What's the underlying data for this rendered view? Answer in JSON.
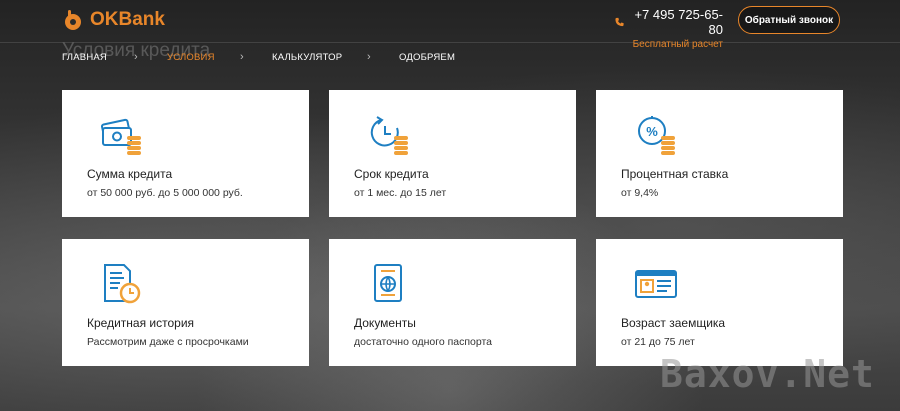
{
  "brand": {
    "name": "OKBank"
  },
  "header": {
    "phone": "+7 495 725-65-80",
    "phone_note": "Бесплатный расчет",
    "callback_label": "Обратный звонок"
  },
  "page_title": "Условия кредита",
  "breadcrumb": [
    "ГЛАВНАЯ",
    "УСЛОВИЯ",
    "КАЛЬКУЛЯТОР",
    "ОДОБРЯЕМ"
  ],
  "cards": [
    {
      "title": "Сумма кредита",
      "text": "от 50 000 руб. до 5 000 000 руб.",
      "icon": "money-icon"
    },
    {
      "title": "Срок кредита",
      "text": "от 1 мес. до 15 лет",
      "icon": "term-clock-icon"
    },
    {
      "title": "Процентная ставка",
      "text": "от 9,4%",
      "icon": "percent-icon"
    },
    {
      "title": "Кредитная история",
      "text": "Рассмотрим даже с просрочками",
      "icon": "history-document-icon"
    },
    {
      "title": "Документы",
      "text": "достаточно одного паспорта",
      "icon": "passport-icon"
    },
    {
      "title": "Возраст заемщика",
      "text": "от 21 до 75 лет",
      "icon": "id-card-icon"
    }
  ],
  "watermark": "Baxov.Net",
  "colors": {
    "accent": "#e8862a",
    "icon_blue": "#1e7fc2",
    "coin": "#f0a23a"
  }
}
